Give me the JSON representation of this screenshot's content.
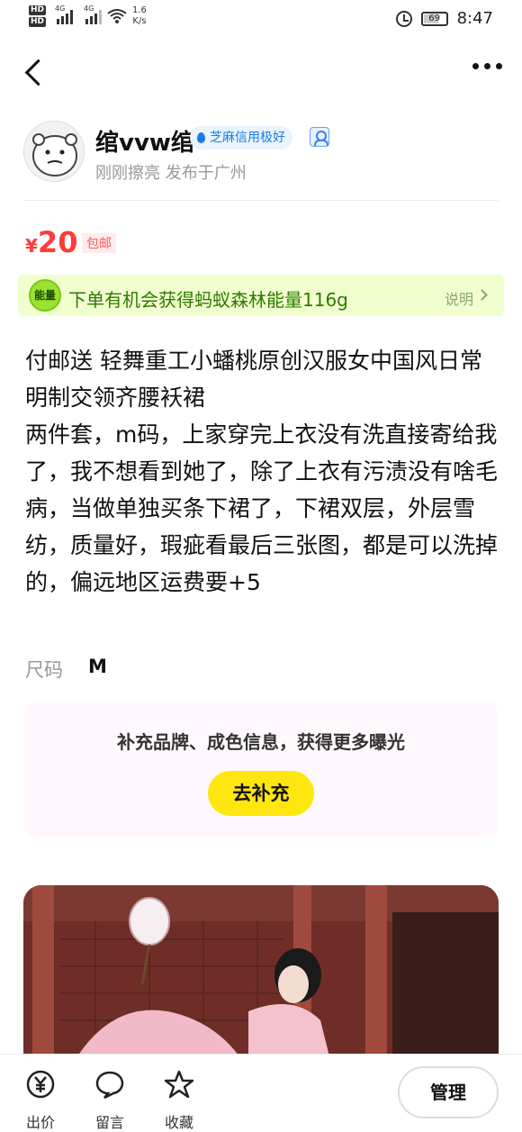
{
  "status_bar": {
    "hd1": "HD",
    "hd2": "HD",
    "net1": "4G",
    "net2": "4G",
    "speed_value": "1.6",
    "speed_unit": "K/s",
    "battery": "69",
    "time": "8:47"
  },
  "seller": {
    "name": "绾vvw绾",
    "credit_badge": "芝麻信用极好",
    "publish_info": "刚刚擦亮 发布于广州"
  },
  "price": {
    "currency": "¥",
    "amount": "20",
    "shipping": "包邮"
  },
  "energy": {
    "badge": "能量",
    "text": "下单有机会获得蚂蚁森林能量116g",
    "help": "说明"
  },
  "description": "付邮送 轻舞重工小蟠桃原创汉服女中国风日常明制交领齐腰袄裙\n两件套，m码，上家穿完上衣没有洗直接寄给我了，我不想看到她了，除了上衣有污渍没有啥毛病，当做单独买条下裙了，下裙双层，外层雪纺，质量好，瑕疵看最后三张图，都是可以洗掉的，偏远地区运费要+5",
  "attributes": {
    "size_label": "尺码",
    "size_value": "M"
  },
  "supplement": {
    "prompt": "补充品牌、成色信息，获得更多曝光",
    "button": "去补充"
  },
  "bottom_bar": {
    "offer": "出价",
    "message": "留言",
    "favorite": "收藏",
    "manage": "管理"
  },
  "colors": {
    "price_red": "#ff3b3b",
    "energy_bg": "#f1ffcf",
    "energy_text": "#2f7a00",
    "button_yellow": "#ffe60f",
    "credit_blue": "#1b7de3"
  },
  "icons": [
    "back-icon",
    "more-icon",
    "wifi-icon",
    "alarm-icon",
    "battery-icon",
    "offer-icon",
    "message-icon",
    "favorite-icon"
  ]
}
